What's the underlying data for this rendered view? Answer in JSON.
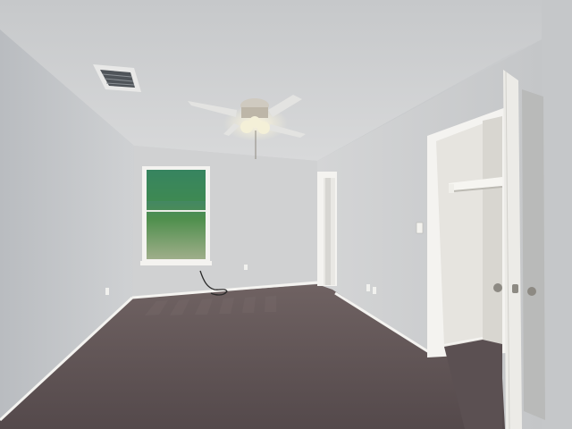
{
  "scene": {
    "subject": "empty-bedroom",
    "colors": {
      "ceiling": "#c6c8ca",
      "left_wall": "#c3c5c8",
      "back_wall": "#d0d1d2",
      "right_wall": "#cfd0d1",
      "far_right_wall": "#c5c7c9",
      "carpet": "#5c5052",
      "carpet_light": "#7a6c6c",
      "trim": "#f4f3f0",
      "window_glass": "#6a9a58",
      "closet_interior": "#e6e4df",
      "door": "#ecebe7",
      "door_shadow": "#b9bab9",
      "fan_blade": "#e3e3e1",
      "fan_light": "#f4f0d8",
      "vent": "#4f5459",
      "hardware": "#8d8a83"
    }
  }
}
